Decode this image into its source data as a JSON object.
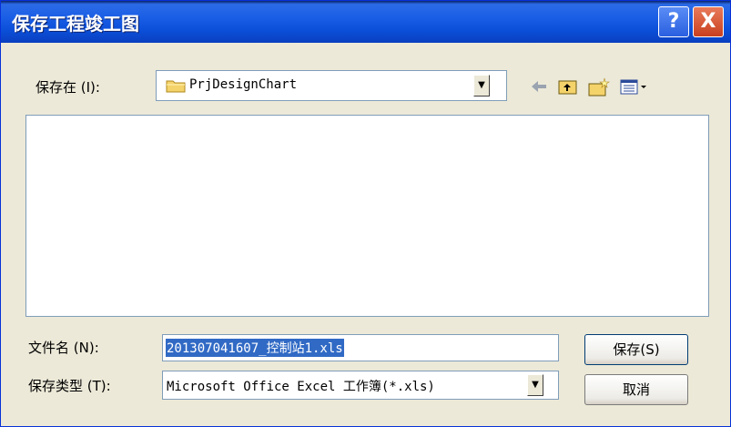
{
  "window": {
    "title": "保存工程竣工图"
  },
  "title_buttons": {
    "help": "?",
    "close": "X"
  },
  "save_in": {
    "label": "保存在 (I):",
    "folder": "PrjDesignChart"
  },
  "toolbar": {
    "back_icon": "back-arrow-icon",
    "up_icon": "up-folder-icon",
    "new_folder_icon": "new-folder-icon",
    "view_icon": "view-menu-icon"
  },
  "file_name": {
    "label": "文件名 (N):",
    "value": "201307041607_控制站1.xls"
  },
  "file_type": {
    "label": "保存类型 (T):",
    "value": "Microsoft Office Excel 工作簿(*.xls)"
  },
  "buttons": {
    "save": "保存(S)",
    "cancel": "取消"
  }
}
